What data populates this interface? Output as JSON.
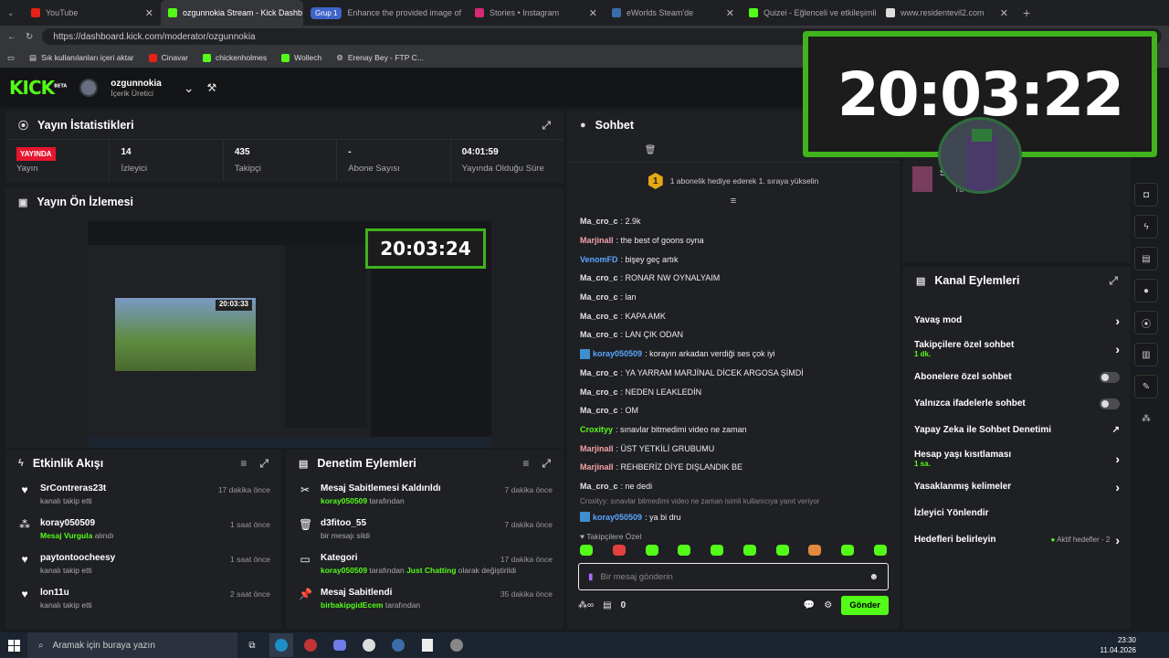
{
  "browser": {
    "tabs": [
      {
        "label": "YouTube",
        "active": false
      },
      {
        "label": "ozgunnokia Stream - Kick Dashb",
        "active": true
      },
      {
        "label": "Enhance the provided image of",
        "active": false,
        "group": "Grup 1"
      },
      {
        "label": "Stories • Instagram",
        "active": false
      },
      {
        "label": "eWorlds Steam'de",
        "active": false
      },
      {
        "label": "Quizei - Eğlenceli ve etkileşimli",
        "active": false
      },
      {
        "label": "www.residentevil2.com",
        "active": false
      }
    ],
    "url": "https://dashboard.kick.com/moderator/ozgunnokia",
    "bookmarks": [
      "Sık kullanılanları içeri aktar",
      "Cinavar",
      "chickenholmes",
      "Wollech",
      "Erenay Bey - FTP C..."
    ]
  },
  "header": {
    "logo": "KICK",
    "logo_badge": "BETA",
    "channel_name": "ozgunnokia",
    "channel_role": "İçerik Üretici"
  },
  "clock_overlay": "20:03:22",
  "stats": {
    "title": "Yayın İstatistikleri",
    "live_badge": "YAYINDA",
    "live_label": "Yayın",
    "items": [
      {
        "value": "14",
        "label": "İzleyici"
      },
      {
        "value": "435",
        "label": "Takipçi"
      },
      {
        "value": "-",
        "label": "Abone Sayısı"
      },
      {
        "value": "04:01:59",
        "label": "Yayında Olduğu Süre"
      }
    ]
  },
  "preview": {
    "title": "Yayın Ön İzlemesi",
    "inner_clock": "20:03:24",
    "inner_clock_2": "20:03:33"
  },
  "activity": {
    "title": "Etkinlik Akışı",
    "items": [
      {
        "user": "SrContreras23t",
        "text": "kanalı takip etti",
        "time": "17 dakika önce",
        "icon": "heart"
      },
      {
        "user": "koray050509",
        "text": "alındı",
        "highlight": "Mesaj Vurgula",
        "time": "1 saat önce",
        "icon": "dots"
      },
      {
        "user": "paytontoocheesy",
        "text": "kanalı takip etti",
        "time": "1 saat önce",
        "icon": "heart"
      },
      {
        "user": "lon11u",
        "text": "kanalı takip etti",
        "time": "2 saat önce",
        "icon": "heart"
      }
    ]
  },
  "modlog": {
    "title": "Denetim Eylemleri",
    "items": [
      {
        "title": "Mesaj Sabitlemesi Kaldırıldı",
        "by": "koray050509",
        "suffix": "tarafından",
        "time": "7 dakika önce"
      },
      {
        "title": "d3fitoo_55",
        "by": "",
        "suffix": "bir mesajı sildi",
        "time": "7 dakika önce"
      },
      {
        "title": "Kategori",
        "by": "koray050509",
        "suffix": "tarafından",
        "category": "Just Chatting",
        "suffix2": "olarak değiştirildi",
        "time": "17 dakika önce"
      },
      {
        "title": "Mesaj Sabitlendi",
        "by": "birbakipgidEcem",
        "suffix": "tarafından",
        "time": "35 dakika önce"
      }
    ]
  },
  "chat": {
    "title": "Sohbet",
    "gift_notice": "1 abonelik hediye ederek 1. sıraya yükselin",
    "messages": [
      {
        "user": "Ma_cro_c",
        "color": "#e4e4e4",
        "text": "2.9k"
      },
      {
        "user": "Marjinall",
        "color": "#f2a3a8",
        "text": "the best of goons oyna"
      },
      {
        "user": "VenomFD",
        "color": "#58a6ff",
        "text": "bişey geç artık"
      },
      {
        "user": "Ma_cro_c",
        "color": "#e4e4e4",
        "text": "RONAR NW OYNALYAIM"
      },
      {
        "user": "Ma_cro_c",
        "color": "#e4e4e4",
        "text": "lan"
      },
      {
        "user": "Ma_cro_c",
        "color": "#e4e4e4",
        "text": "KAPA AMK"
      },
      {
        "user": "Ma_cro_c",
        "color": "#e4e4e4",
        "text": "LAN ÇIK ODAN"
      },
      {
        "user": "koray050509",
        "color": "#58a6ff",
        "text": "korayın arkadan verdiği ses çok iyi",
        "badge": true
      },
      {
        "user": "Ma_cro_c",
        "color": "#e4e4e4",
        "text": "YA YARRAM MARJİNAL DİCEK ARGOSA ŞİMDİ"
      },
      {
        "user": "Ma_cro_c",
        "color": "#e4e4e4",
        "text": "NEDEN LEAKLEDİN"
      },
      {
        "user": "Ma_cro_c",
        "color": "#e4e4e4",
        "text": "OM"
      },
      {
        "user": "Croxityy",
        "color": "#53fc18",
        "text": "sınavlar bitmedimi video ne zaman"
      },
      {
        "user": "Marjinall",
        "color": "#f2a3a8",
        "text": "ÜST YETKİLİ GRUBUMU"
      },
      {
        "user": "Marjinall",
        "color": "#f2a3a8",
        "text": "REHBERİZ DİYE DIŞLANDIK BE"
      },
      {
        "user": "Ma_cro_c",
        "color": "#e4e4e4",
        "text": "ne dedi"
      }
    ],
    "reply_ref": "Croxityy: sınavlar bitmedimi video ne zaman isimli kullanıcıya yanıt veriyor",
    "reply_msg": {
      "user": "koray050509",
      "text": "ya bi dru"
    },
    "emote_section": "Takipçilere Özel",
    "input_placeholder": "Bir mesaj gönderin",
    "counter": "0",
    "send_label": "Gönder"
  },
  "channel_actions": {
    "title": "Kanal Eylemleri",
    "items": [
      {
        "label": "Yavaş mod",
        "type": "chevron"
      },
      {
        "label": "Takipçilere özel sohbet",
        "sub": "1 dk.",
        "type": "chevron"
      },
      {
        "label": "Abonelere özel sohbet",
        "type": "toggle"
      },
      {
        "label": "Yalnızca ifadelerle sohbet",
        "type": "toggle"
      },
      {
        "label": "Yapay Zeka ile Sohbet Denetimi",
        "type": "external"
      },
      {
        "label": "Hesap yaşı kısıtlaması",
        "sub": "1 sa.",
        "type": "chevron"
      },
      {
        "label": "Yasaklanmış kelimeler",
        "type": "chevron"
      },
      {
        "label": "İzleyici Yönlendir",
        "type": "none"
      },
      {
        "label": "Hedefleri belirleyin",
        "type": "chevron",
        "status": "Aktif hedefler - 2"
      }
    ]
  },
  "mini_user": {
    "initial": "S",
    "name": "Tu"
  },
  "taskbar": {
    "search_placeholder": "Aramak için buraya yazın",
    "time": "23:30",
    "date": "11.04.2026"
  }
}
